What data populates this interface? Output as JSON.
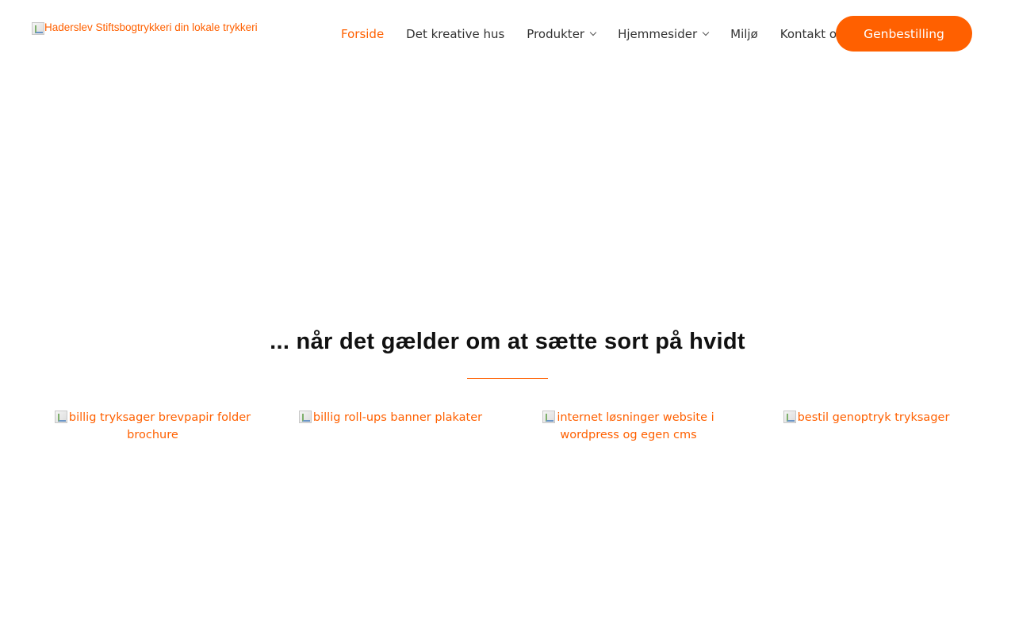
{
  "header": {
    "logo_alt": "Haderslev Stiftsbogtrykkeri din lokale trykkeri",
    "nav": [
      {
        "label": "Forside",
        "active": true,
        "dropdown": false
      },
      {
        "label": "Det kreative hus",
        "active": false,
        "dropdown": false
      },
      {
        "label": "Produkter",
        "active": false,
        "dropdown": true
      },
      {
        "label": "Hjemmesider",
        "active": false,
        "dropdown": true
      },
      {
        "label": "Miljø",
        "active": false,
        "dropdown": false
      },
      {
        "label": "Kontakt os",
        "active": false,
        "dropdown": false
      }
    ],
    "cta_label": "Genbestilling"
  },
  "hero": {
    "tagline": "... når det gælder om at sætte sort på hvidt"
  },
  "tiles": [
    {
      "alt": "billig tryksager brevpapir folder brochure"
    },
    {
      "alt": "billig roll-ups banner plakater"
    },
    {
      "alt": "internet løsninger website i wordpress og egen cms"
    },
    {
      "alt": "bestil genoptryk tryksager"
    }
  ],
  "colors": {
    "accent": "#ff6000",
    "nav_text": "#333333",
    "heading": "#111111",
    "background": "#ffffff"
  },
  "icons": {
    "broken_image": "broken-image-icon",
    "dropdown": "chevron-down-icon"
  }
}
